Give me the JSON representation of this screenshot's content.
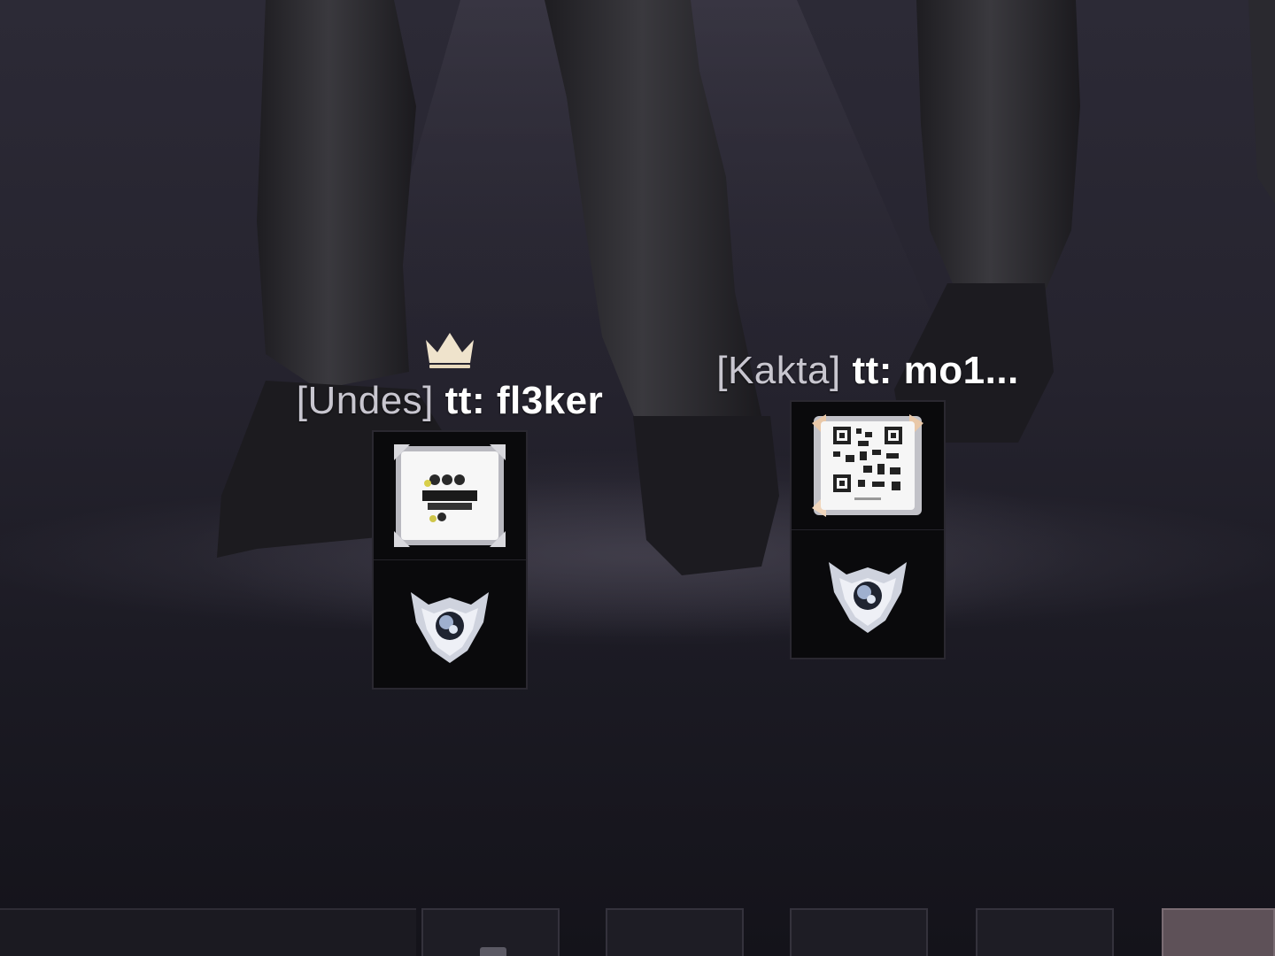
{
  "players": [
    {
      "clan_tag": "[Undes]",
      "nickname": "tt: fl3ker",
      "is_leader": true,
      "leader_icon": "crown-icon",
      "badges": [
        "custom-avatar-badge",
        "rank-emblem-icon"
      ]
    },
    {
      "clan_tag": "[Kakta]",
      "nickname": "tt: mo1...",
      "is_leader": false,
      "badges": [
        "qr-code-avatar-badge",
        "rank-emblem-icon"
      ]
    }
  ],
  "colors": {
    "background": "#16141d",
    "name_text": "#ffffff",
    "clan_tag_text": "#c8c6cf",
    "crown": "#efe3cc",
    "badge_panel": "#0a0a0c",
    "active_slot": "#5e5158"
  },
  "bottom_bar": {
    "slot_count": 5,
    "active_slot_index": 4
  }
}
